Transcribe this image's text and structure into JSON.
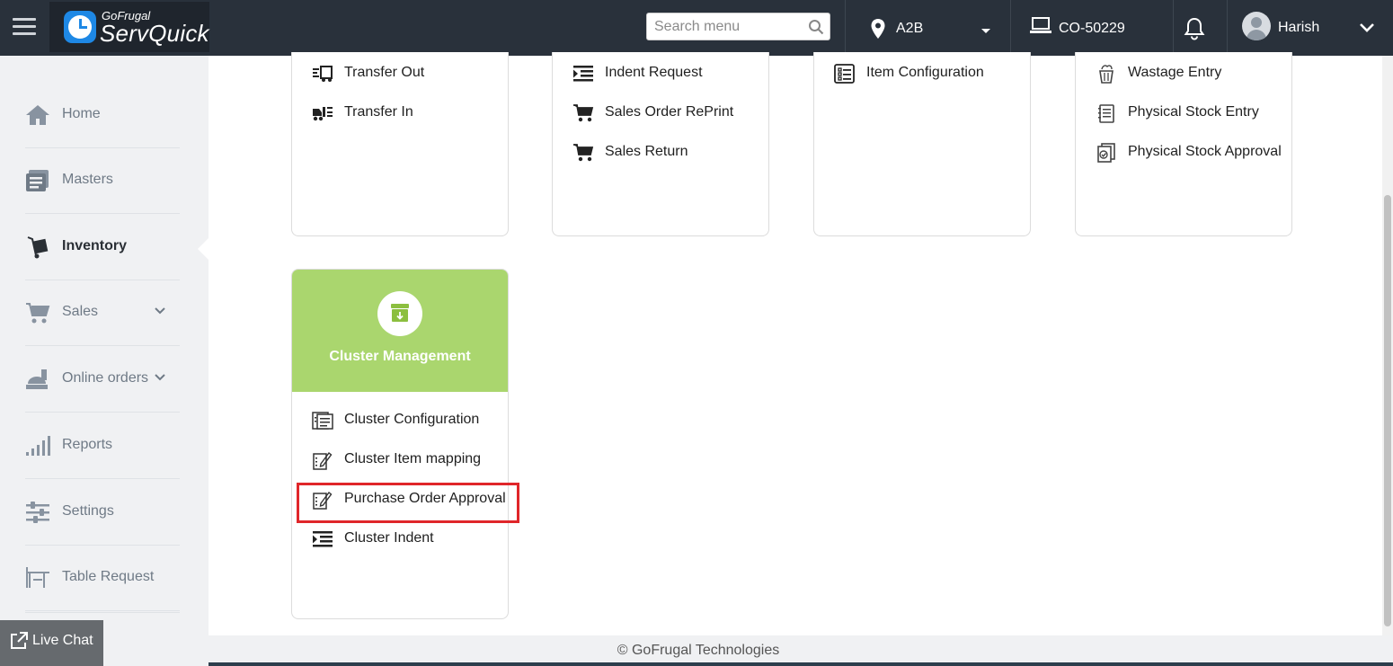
{
  "header": {
    "menu_icon": "hamburger-icon",
    "logo_small": "GoFrugal",
    "logo_big": "ServQuick",
    "search_placeholder": "Search menu",
    "location": "A2B",
    "terminal": "CO-50229",
    "user_name": "Harish",
    "colors": {
      "bar": "#29313b",
      "logo_bg": "#1f252d"
    }
  },
  "sidebar": {
    "items": [
      {
        "label": "Home",
        "icon": "home-icon"
      },
      {
        "label": "Masters",
        "icon": "masters-icon"
      },
      {
        "label": "Inventory",
        "icon": "inventory-icon",
        "active": true
      },
      {
        "label": "Sales",
        "icon": "cart-icon",
        "dropdown": true
      },
      {
        "label": "Online orders",
        "icon": "online-orders-icon",
        "dropdown": true
      },
      {
        "label": "Reports",
        "icon": "reports-icon"
      },
      {
        "label": "Settings",
        "icon": "settings-icon"
      },
      {
        "label": "Table Request",
        "icon": "table-icon"
      }
    ],
    "live_chat": "Live Chat"
  },
  "cards": {
    "transfer": {
      "items": [
        "Transfer Out",
        "Transfer In"
      ]
    },
    "sales_ops": {
      "items": [
        "Indent Request",
        "Sales Order RePrint",
        "Sales Return"
      ]
    },
    "config": {
      "items": [
        "Item Configuration"
      ]
    },
    "stock": {
      "items": [
        "Wastage Entry",
        "Physical Stock Entry",
        "Physical Stock Approval"
      ]
    },
    "cluster": {
      "title": "Cluster Management",
      "head_color": "#aad66e",
      "items": [
        "Cluster Configuration",
        "Cluster Item mapping",
        "Purchase Order Approval",
        "Cluster Indent"
      ],
      "highlighted_item": "Purchase Order Approval",
      "highlight_color": "#e0262a"
    }
  },
  "footer": "© GoFrugal Technologies"
}
